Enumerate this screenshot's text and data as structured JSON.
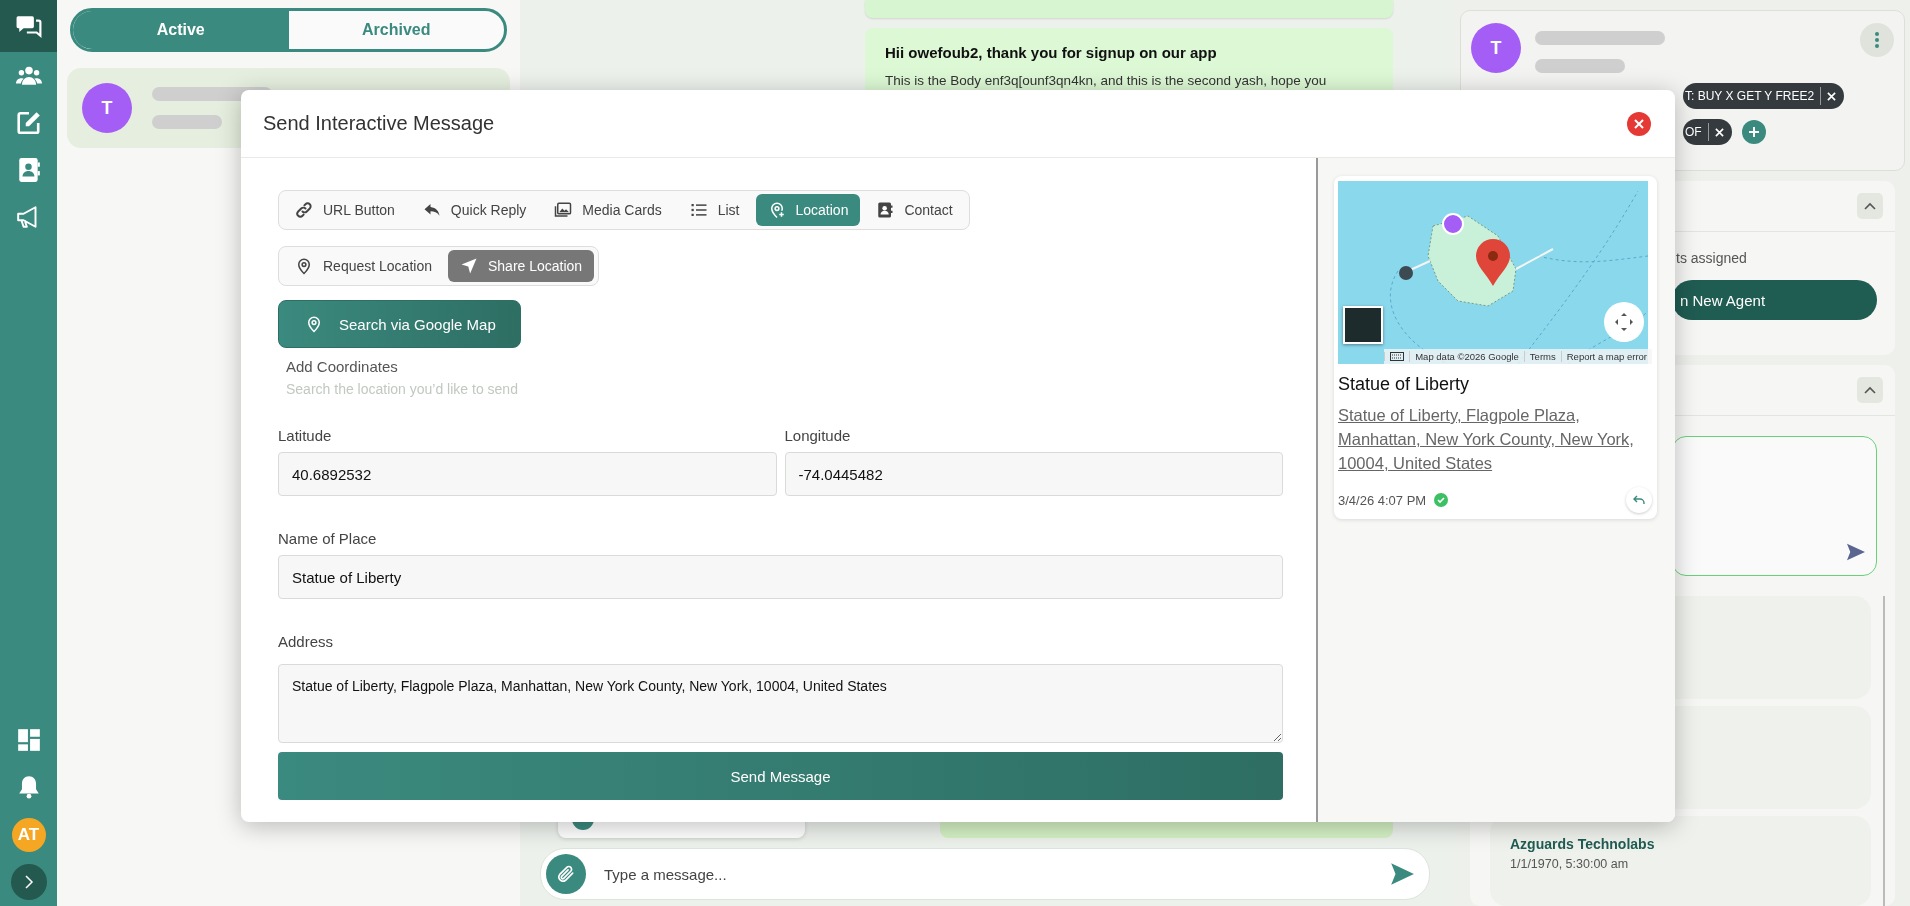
{
  "nav": {
    "items": [
      {
        "kind": "chats",
        "selected": true
      },
      {
        "kind": "contacts",
        "selected": false
      },
      {
        "kind": "compose",
        "selected": false
      },
      {
        "kind": "phonebook",
        "selected": false
      },
      {
        "kind": "broadcast",
        "selected": false
      }
    ],
    "bottom_items": [
      {
        "kind": "dashboard",
        "selected": false
      },
      {
        "kind": "notifications",
        "selected": false
      }
    ],
    "user_initials": "AT"
  },
  "chat_list": {
    "tabs": [
      {
        "label": "Active",
        "selected": true
      },
      {
        "label": "Archived",
        "selected": false
      }
    ],
    "conversations": [
      {
        "initial": "T",
        "selected": true
      }
    ]
  },
  "chat": {
    "messages": [
      {
        "title": "Hii owefoub2, thank you for signup on our app",
        "body": "This is the Body enf3q[ounf3qn4kn, and this is the second yash, hope you"
      }
    ],
    "composer": {
      "placeholder": "Type a message..."
    }
  },
  "contact": {
    "initial": "T",
    "tags": [
      {
        "label": "T: BUY X GET Y FREE2"
      },
      {
        "label": "OF"
      }
    ],
    "agents_text": "ts assigned",
    "agent_button": "n New Agent",
    "history": [
      {
        "title": "Azguards Technolabs",
        "time": "1/1/1970, 5:30:00 am"
      }
    ]
  },
  "modal": {
    "title": "Send Interactive Message",
    "types": [
      {
        "kind": "link",
        "label": "URL Button",
        "selected": false
      },
      {
        "kind": "reply",
        "label": "Quick Reply",
        "selected": false
      },
      {
        "kind": "media",
        "label": "Media Cards",
        "selected": false
      },
      {
        "kind": "list",
        "label": "List",
        "selected": false
      },
      {
        "kind": "location",
        "label": "Location",
        "selected": true
      },
      {
        "kind": "contact",
        "label": "Contact",
        "selected": false
      }
    ],
    "location_modes": [
      {
        "kind": "pin",
        "label": "Request Location",
        "selected": false
      },
      {
        "kind": "navigate",
        "label": "Share Location",
        "selected": true
      }
    ],
    "search_button": "Search via Google Map",
    "coords_title": "Add Coordinates",
    "coords_hint": "Search the location you’d like to send",
    "fields": [
      {
        "kind": "half",
        "label": "Latitude",
        "value": "40.6892532"
      },
      {
        "kind": "half",
        "label": "Longitude",
        "value": "-74.0445482"
      },
      {
        "kind": "full",
        "label": "Name of Place",
        "value": "Statue of Liberty"
      },
      {
        "kind": "textarea",
        "label": "Address",
        "value": "Statue of Liberty, Flagpole Plaza, Manhattan, New York County, New York, 10004, United States"
      }
    ],
    "send_button": "Send Message",
    "preview": {
      "map_attribution": "Map data ©2026 Google",
      "map_links": [
        "Terms",
        "Report a map error"
      ],
      "title": "Statue of Liberty",
      "address": "Statue of Liberty, Flagpole Plaza, Manhattan, New York County, New York, 10004, United States",
      "time": "3/4/26 4:07 PM",
      "delivered": true
    }
  }
}
